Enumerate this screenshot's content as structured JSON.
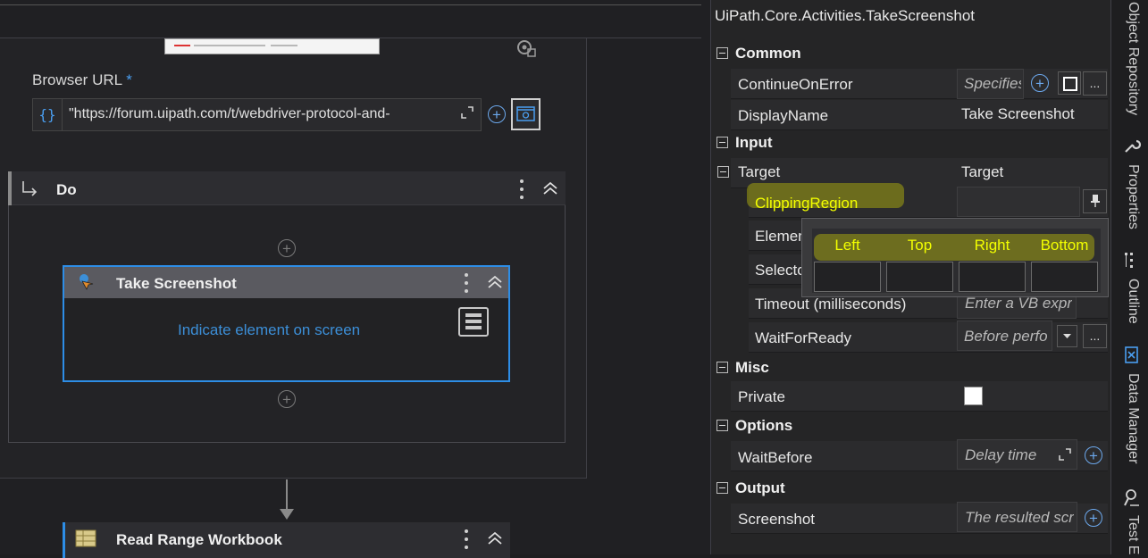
{
  "designer": {
    "browser_url_label": "Browser URL",
    "required_mark": "*",
    "browser_url_value": "\"https://forum.uipath.com/t/webdriver-protocol-and-",
    "do_title": "Do",
    "take_screenshot_title": "Take Screenshot",
    "indicate_link": "Indicate element on screen",
    "read_range_title": "Read Range Workbook"
  },
  "properties": {
    "title": "UiPath.Core.Activities.TakeScreenshot",
    "sections": {
      "common": "Common",
      "input": "Input",
      "misc": "Misc",
      "options": "Options",
      "output": "Output"
    },
    "rows": {
      "continue_on_error": {
        "name": "ContinueOnError",
        "value": "Specifies"
      },
      "display_name": {
        "name": "DisplayName",
        "value": "Take Screenshot"
      },
      "target": {
        "name": "Target",
        "value": "Target"
      },
      "clipping_region": {
        "name": "ClippingRegion",
        "value": ""
      },
      "element": {
        "name": "Element",
        "value": ""
      },
      "selector": {
        "name": "Selector",
        "value": ""
      },
      "timeout": {
        "name": "Timeout (milliseconds)",
        "value": "Enter a VB expr"
      },
      "wait_for_ready": {
        "name": "WaitForReady",
        "value": "Before perfo"
      },
      "private": {
        "name": "Private",
        "value": ""
      },
      "wait_before": {
        "name": "WaitBefore",
        "value": "Delay time"
      },
      "screenshot": {
        "name": "Screenshot",
        "value": "The resulted scr"
      }
    },
    "ellipsis": "...",
    "clipping_popup": {
      "left": "Left",
      "top": "Top",
      "right": "Right",
      "bottom": "Bottom"
    }
  },
  "dock_tabs": [
    "Object Repository",
    "Properties",
    "Outline",
    "Data Manager",
    "Test E"
  ],
  "colors": {
    "accent": "#2d8de6",
    "highlight": "#e6e600",
    "popup_text": "#f3ff00"
  },
  "icons": [
    "browser-icon",
    "expand-icon",
    "plus-circle-icon",
    "more-vert-icon",
    "collapse-icon",
    "pin-icon",
    "wrench-icon",
    "outline-icon",
    "data-manager-icon",
    "test-explorer-icon"
  ]
}
